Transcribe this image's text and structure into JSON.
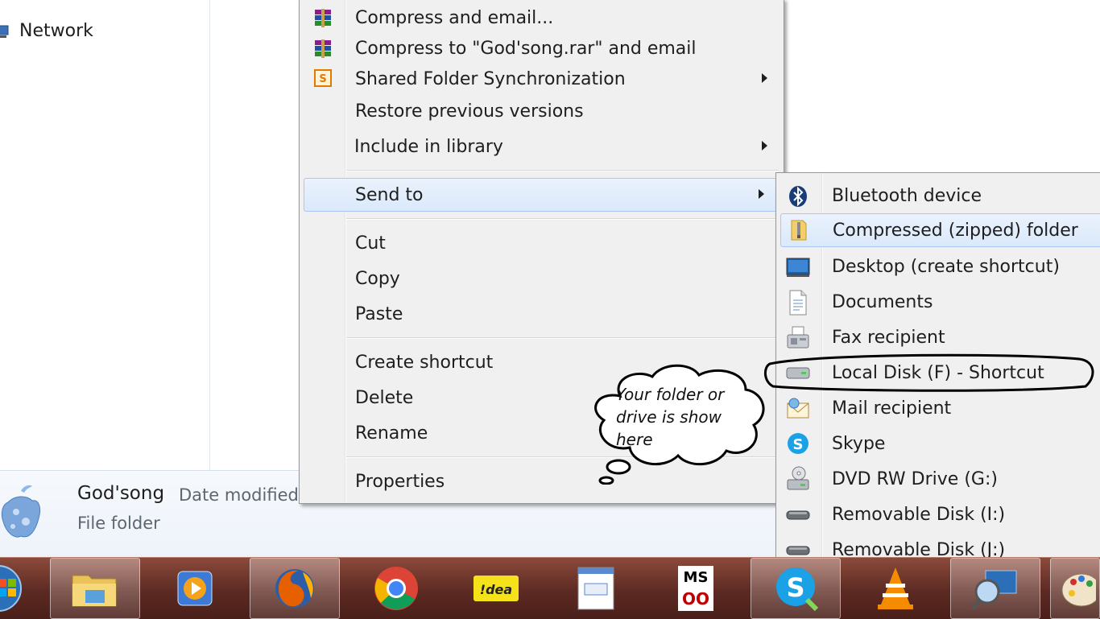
{
  "nav": {
    "network_label": "Network"
  },
  "details": {
    "name": "God'song",
    "date_label": "Date modified",
    "type": "File folder"
  },
  "context_menu": {
    "items": [
      {
        "label": "Compress and email...",
        "icon": "winrar-icon"
      },
      {
        "label": "Compress to \"God'song.rar\" and email",
        "icon": "winrar-icon"
      },
      {
        "label": "Shared Folder Synchronization",
        "icon": "sync-icon",
        "sync_glyph": "S"
      },
      {
        "label": "Restore previous versions"
      },
      {
        "label": "Include in library"
      },
      {
        "label": "Send to"
      },
      {
        "label": "Cut"
      },
      {
        "label": "Copy"
      },
      {
        "label": "Paste"
      },
      {
        "label": "Create shortcut"
      },
      {
        "label": "Delete"
      },
      {
        "label": "Rename"
      },
      {
        "label": "Properties"
      }
    ]
  },
  "send_to": {
    "items": [
      {
        "label": "Bluetooth device",
        "icon": "bluetooth-icon"
      },
      {
        "label": "Compressed (zipped) folder",
        "icon": "zip-folder-icon"
      },
      {
        "label": "Desktop (create shortcut)",
        "icon": "desktop-icon"
      },
      {
        "label": "Documents",
        "icon": "document-icon"
      },
      {
        "label": "Fax recipient",
        "icon": "fax-icon"
      },
      {
        "label": "Local Disk (F) - Shortcut",
        "icon": "drive-icon"
      },
      {
        "label": "Mail recipient",
        "icon": "mail-icon"
      },
      {
        "label": "Skype",
        "icon": "skype-icon"
      },
      {
        "label": "DVD RW Drive (G:)",
        "icon": "dvd-drive-icon"
      },
      {
        "label": "Removable Disk (I:)",
        "icon": "removable-disk-icon"
      },
      {
        "label": "Removable Disk (J:)",
        "icon": "removable-disk-icon"
      }
    ]
  },
  "callout": {
    "line1": "Your folder or",
    "line2": "drive is show",
    "line3": "here"
  },
  "taskbar": {
    "idea_text": "!dea",
    "ms_text": "MS",
    "ms_sub": "OO"
  },
  "colors": {
    "taskbar": "#5c2a22",
    "menu_bg": "#f0f0f0",
    "highlight": "#dbe9fb"
  }
}
